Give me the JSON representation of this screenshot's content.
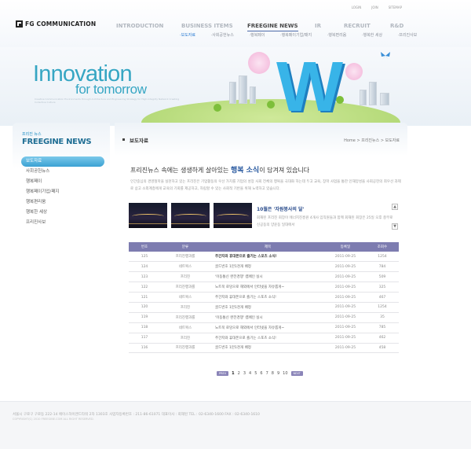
{
  "brand": "FG COMMUNICATION",
  "util": [
    "LOGIN",
    "JOIN",
    "SITEMAP"
  ],
  "gnb": [
    "INTRODUCTION",
    "BUSINESS ITEMS",
    "FREEGINE NEWS",
    "IR",
    "RECRUIT",
    "R&D"
  ],
  "subnav": [
    "보도자료",
    "사회공헌뉴스",
    "행복페이",
    "행복페이기업/패지",
    "행복편리움",
    "행복한 세상",
    "프리진사보"
  ],
  "hero": {
    "title": "Innovation",
    "subtitle": "for tomorrow",
    "small_text": "Creative Communication Environments through Architecture and Engineering Strategy for High-Integrity Network Creating Collective Culture"
  },
  "sidebar": {
    "category": "프리진 뉴스",
    "title": "FREEGINE NEWS",
    "items": [
      "보도자료",
      "사회공헌뉴스",
      "행복페이",
      "행복페이기업/패지",
      "행복편리움",
      "행복한 세상",
      "프리진사보"
    ]
  },
  "content": {
    "title": "보도자료",
    "breadcrumb": "Home > 프리진뉴스 > 보도자료",
    "headline_pre": "프리진뉴스 속에는 생생하게 살아있는 ",
    "headline_strong": "행복 소식",
    "headline_post": "이 담겨져 있습니다",
    "intro": "인간중심의 경영철학을 실천하고 있는 프리진은 기업활동의 우선 가치를 기업의 성장 사회 전체의 행복을 극대화 하는데 두고 교육, 장학 사업을 통한 인재양성을 사회공헌의 최우선 과제로 삼고 소외계층에게 교육의 기회를 제공하고, 자립할 수 있는 사회적 기반을 위해 노력하고 있습니다.",
    "featured": {
      "title": "10월은 '자원봉사의 달'",
      "text": "회재된 프리진 회장이 에너지진흥원 4개사 임직원들과 함께 회재된 회장은 25일 오후 충무로 신공동의 양윤동 일대에서"
    },
    "table": {
      "headers": [
        "번호",
        "분류",
        "제목",
        "등록일",
        "조회수"
      ],
      "rows": [
        [
          "125",
          "프리진행과를",
          "주간지와 휴대폰으로 즐기는 스포츠 소식!",
          "2011-09-25",
          "1254"
        ],
        [
          "124",
          "네트웍스",
          "골드번호 1만1천개 배정",
          "2011-09-25",
          "784"
        ],
        [
          "123",
          "프리진",
          "'이동통신 완전경쟁' 캠페인 실시",
          "2011-09-25",
          "509"
        ],
        [
          "122",
          "프리진행과를",
          "노트북 로밍으로 해외에서 인터넷을 자유롭게~",
          "2011-09-25",
          "325"
        ],
        [
          "121",
          "네트웍스",
          "주간지와 휴대폰으로 즐기는 스포츠 소식!",
          "2011-09-25",
          "467"
        ],
        [
          "120",
          "프리진",
          "골드번호 1만1천개 배정",
          "2011-09-25",
          "1254"
        ],
        [
          "119",
          "프리진행과를",
          "'이동통신 완전경쟁' 캠페인 실시",
          "2011-09-25",
          "35"
        ],
        [
          "118",
          "네트웍스",
          "노트북 로밍으로 해외에서 인터넷을 자유롭게~",
          "2011-09-25",
          "785"
        ],
        [
          "117",
          "프리진",
          "주간지와 휴대폰으로 즐기는 스포츠 소식!",
          "2011-09-25",
          "462"
        ],
        [
          "116",
          "프리진행과를",
          "골드번호 1만1천개 배정",
          "2011-09-25",
          "458"
        ]
      ]
    },
    "pager": {
      "prev": "PREV",
      "next": "NEXT",
      "pages": [
        "1",
        "2",
        "3",
        "4",
        "5",
        "6",
        "7",
        "8",
        "9",
        "10"
      ],
      "current": "1"
    }
  },
  "footer": {
    "line1": "서울시 구로구 구로동 222-14 에이스하이엔드타워 2차 1303호  사업자등록번호 : 211-86-61071  대표이사 : 회재된    TEL : 02-6340-1600  FAX : 02-6340-1610",
    "line2": "COPYRIGHT(C) 2010 FREEGINE.COM ALL RIGHT RESERVED."
  }
}
